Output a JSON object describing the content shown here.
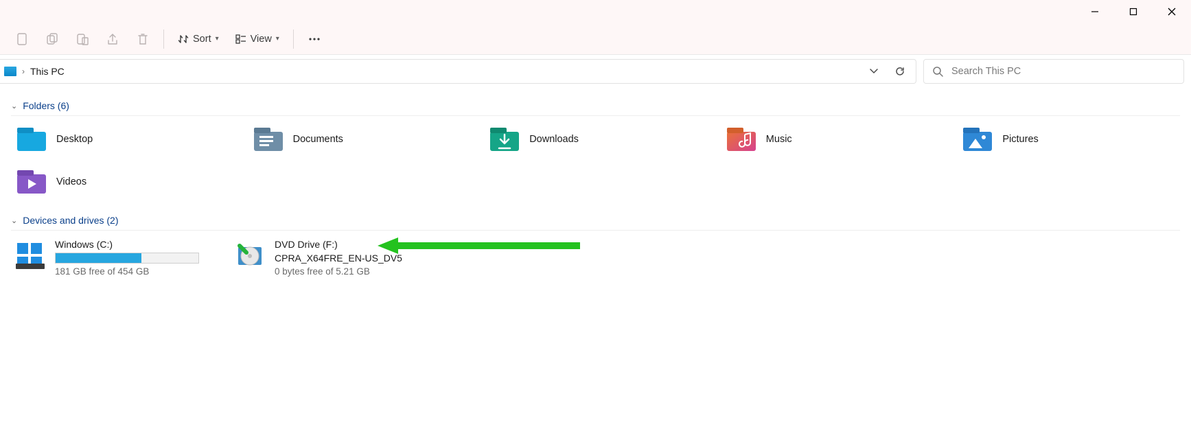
{
  "window": {
    "controls": {
      "min": "minimize",
      "max": "maximize",
      "close": "close"
    }
  },
  "toolbar": {
    "sort_label": "Sort",
    "view_label": "View"
  },
  "breadcrumb": {
    "location": "This PC"
  },
  "search": {
    "placeholder": "Search This PC"
  },
  "groups": {
    "folders": {
      "title": "Folders (6)"
    },
    "drives": {
      "title": "Devices and drives (2)"
    }
  },
  "folders": [
    {
      "name": "Desktop",
      "icon": "desktop"
    },
    {
      "name": "Documents",
      "icon": "documents"
    },
    {
      "name": "Downloads",
      "icon": "downloads"
    },
    {
      "name": "Music",
      "icon": "music"
    },
    {
      "name": "Pictures",
      "icon": "pictures"
    },
    {
      "name": "Videos",
      "icon": "videos"
    }
  ],
  "drives": [
    {
      "name": "Windows (C:)",
      "free_text": "181 GB free of 454 GB",
      "fill_percent": 60
    },
    {
      "name": "DVD Drive (F:)",
      "label": "CPRA_X64FRE_EN-US_DV5",
      "free_text": "0 bytes free of 5.21 GB"
    }
  ]
}
